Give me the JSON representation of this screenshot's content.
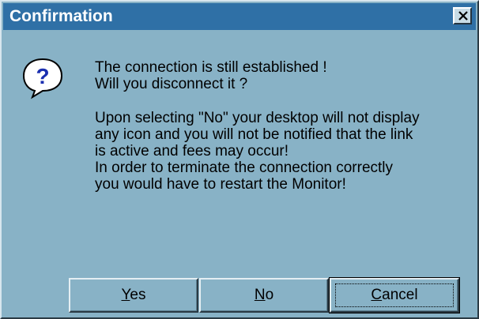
{
  "dialog": {
    "title": "Confirmation",
    "close_glyph": "✕",
    "icon": "question-icon",
    "message_lines_1": [
      "The connection is still established !",
      "Will you disconnect it ?"
    ],
    "message_lines_2": [
      "Upon selecting \"No\" your desktop will not display",
      "any icon and you will not be notified that the link",
      "is active and fees may occur!",
      "In order to terminate the connection correctly",
      "you would have to restart the Monitor!"
    ]
  },
  "buttons": {
    "yes": {
      "mnemonic": "Y",
      "rest": "es"
    },
    "no": {
      "mnemonic": "N",
      "rest": "o"
    },
    "cancel": {
      "mnemonic": "C",
      "rest": "ancel"
    }
  },
  "colors": {
    "dialog_bg": "#88b2c6",
    "titlebar_bg": "#2f70a6",
    "title_text": "#ffffff"
  }
}
